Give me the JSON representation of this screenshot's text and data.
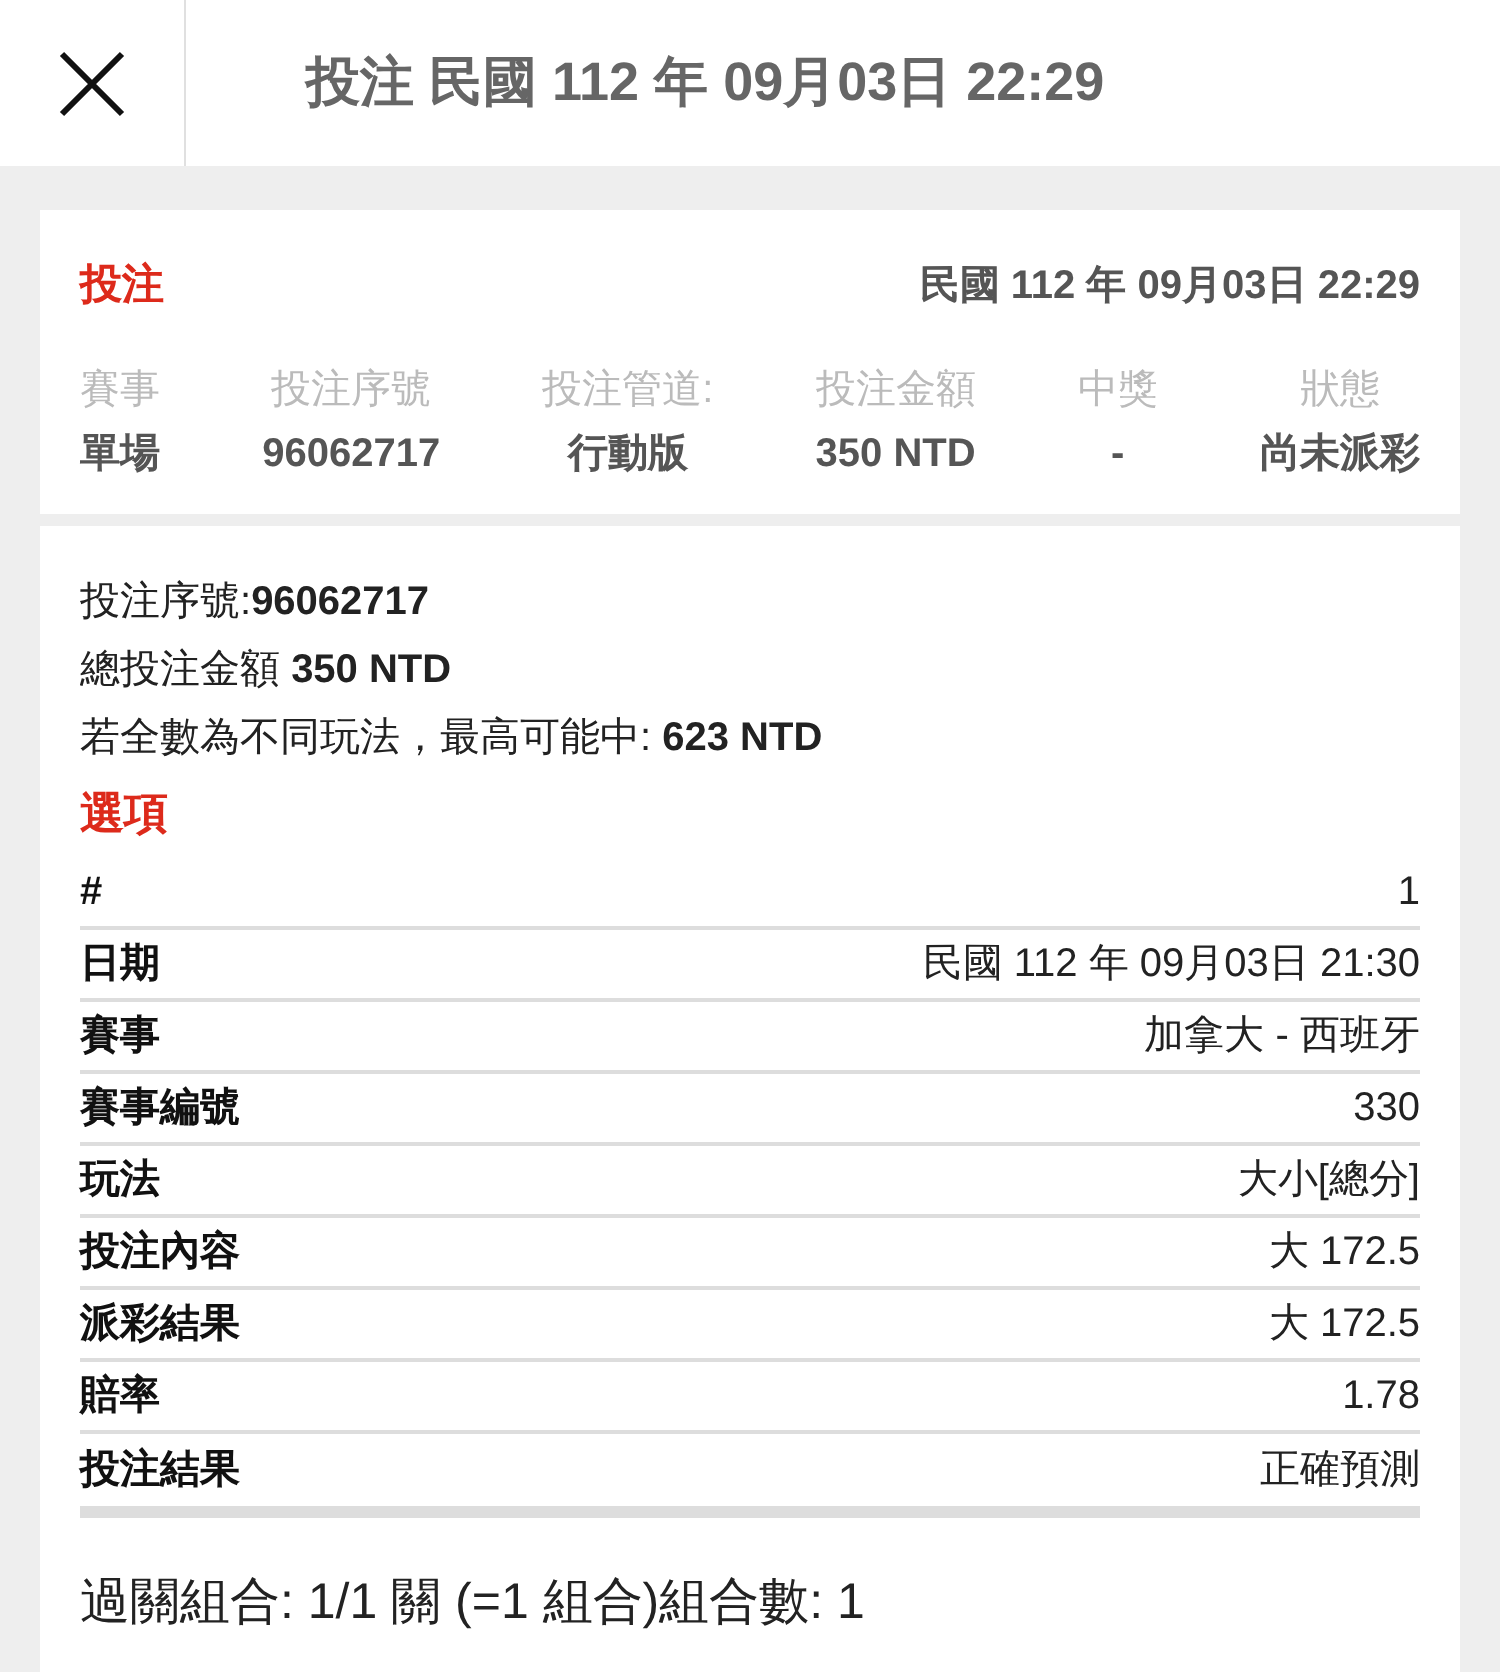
{
  "header": {
    "title": "投注 民國 112 年 09月03日 22:29"
  },
  "summary": {
    "label": "投注",
    "datetime": "民國 112 年 09月03日 22:29",
    "columns": [
      {
        "heading": "賽事",
        "value": "單場"
      },
      {
        "heading": "投注序號",
        "value": "96062717"
      },
      {
        "heading": "投注管道:",
        "value": "行動版"
      },
      {
        "heading": "投注金額",
        "value": "350 NTD"
      },
      {
        "heading": "中獎",
        "value": "-"
      },
      {
        "heading": "狀態",
        "value": "尚未派彩"
      }
    ]
  },
  "details": {
    "lines": [
      "投注序號:**96062717**",
      "總投注金額 **350 NTD**",
      "若全數為不同玩法，最高可能中: **623 NTD**"
    ],
    "options_title": "選項",
    "rows": [
      {
        "label": "#",
        "value": "1"
      },
      {
        "label": "日期",
        "value": "民國 112 年 09月03日 21:30"
      },
      {
        "label": "賽事",
        "value": "加拿大 - 西班牙"
      },
      {
        "label": "賽事編號",
        "value": "330"
      },
      {
        "label": "玩法",
        "value": "大小[總分]"
      },
      {
        "label": "投注內容",
        "value": "大 172.5"
      },
      {
        "label": "派彩結果",
        "value": "大 172.5"
      },
      {
        "label": "賠率",
        "value": "1.78"
      },
      {
        "label": "投注結果",
        "value": "正確預測"
      }
    ],
    "combo": "過關組合: 1/1 關 (=1 組合)組合數: 1"
  }
}
